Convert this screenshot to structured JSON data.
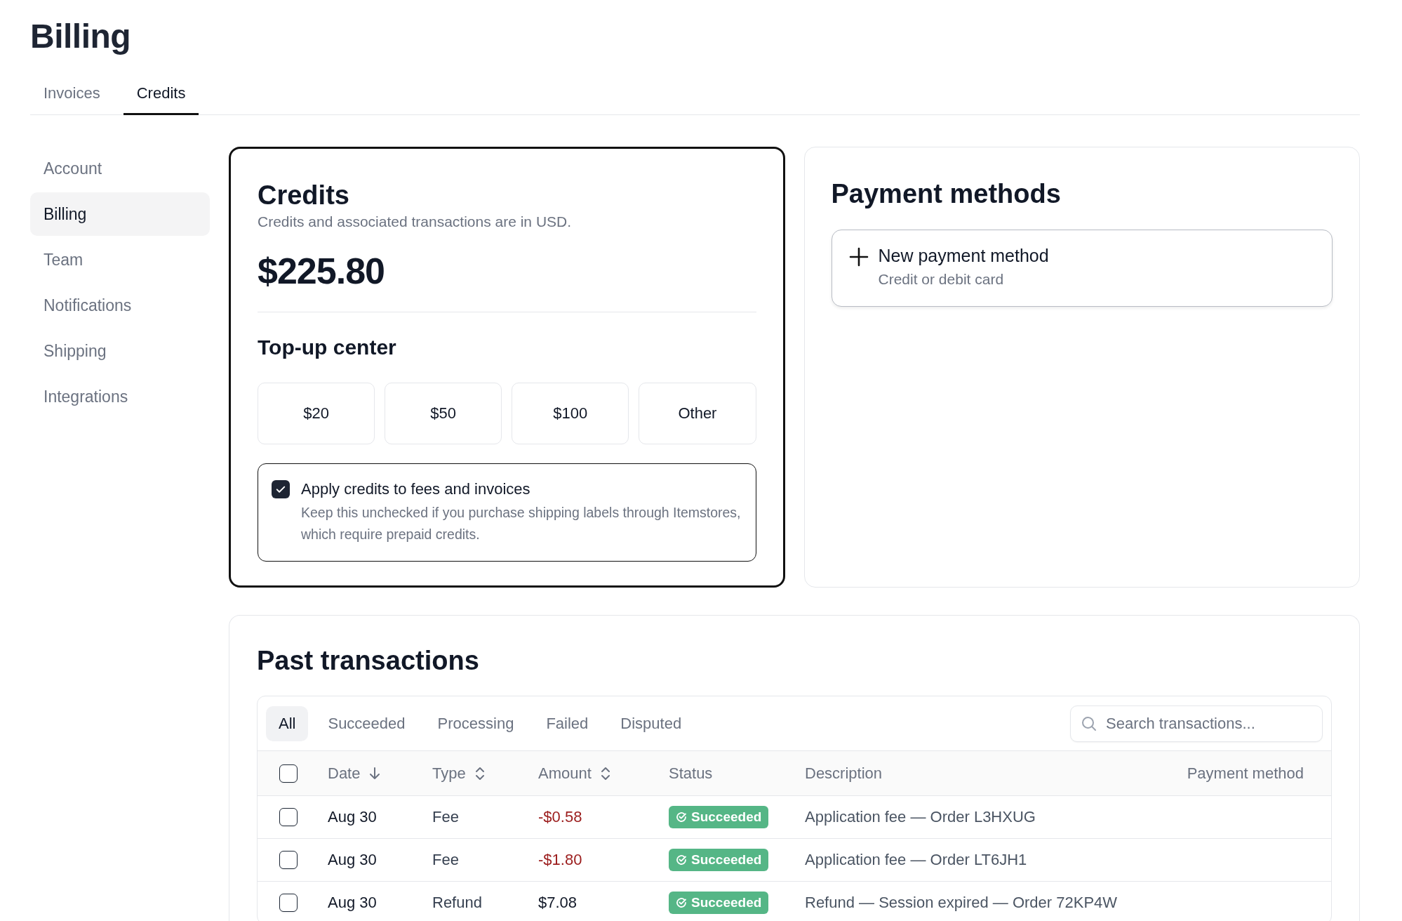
{
  "page": {
    "title": "Billing"
  },
  "tabs": [
    {
      "label": "Invoices",
      "selected": false
    },
    {
      "label": "Credits",
      "selected": true
    }
  ],
  "sidebar": {
    "items": [
      {
        "label": "Account",
        "selected": false
      },
      {
        "label": "Billing",
        "selected": true
      },
      {
        "label": "Team",
        "selected": false
      },
      {
        "label": "Notifications",
        "selected": false
      },
      {
        "label": "Shipping",
        "selected": false
      },
      {
        "label": "Integrations",
        "selected": false
      }
    ]
  },
  "credits": {
    "title": "Credits",
    "subtitle": "Credits and associated transactions are in USD.",
    "balance": "$225.80",
    "topup_title": "Top-up center",
    "topup_options": [
      "$20",
      "$50",
      "$100",
      "Other"
    ],
    "apply": {
      "label": "Apply credits to fees and invoices",
      "description": "Keep this unchecked if you purchase shipping labels through Itemstores, which require prepaid credits.",
      "checked": true
    }
  },
  "payment_methods": {
    "title": "Payment methods",
    "new_method": {
      "label": "New payment method",
      "sublabel": "Credit or debit card"
    }
  },
  "transactions": {
    "title": "Past transactions",
    "filters": [
      {
        "label": "All",
        "selected": true
      },
      {
        "label": "Succeeded",
        "selected": false
      },
      {
        "label": "Processing",
        "selected": false
      },
      {
        "label": "Failed",
        "selected": false
      },
      {
        "label": "Disputed",
        "selected": false
      }
    ],
    "search": {
      "placeholder": "Search transactions..."
    },
    "select_all": {
      "checked": false
    },
    "columns": [
      {
        "label": "Date",
        "kind": "sorted"
      },
      {
        "label": "Type",
        "kind": "sortable"
      },
      {
        "label": "Amount",
        "kind": "sortable"
      },
      {
        "label": "Status",
        "kind": "plain"
      },
      {
        "label": "Description",
        "kind": "plain"
      },
      {
        "label": "Payment method",
        "kind": "plain"
      }
    ],
    "rows": [
      {
        "checked": false,
        "date": "Aug 30",
        "type": "Fee",
        "amount": "-$0.58",
        "negative": true,
        "status": {
          "label": "Succeeded",
          "kind": "succeeded"
        },
        "description": "Application fee — Order L3HXUG"
      },
      {
        "checked": false,
        "date": "Aug 30",
        "type": "Fee",
        "amount": "-$1.80",
        "negative": true,
        "status": {
          "label": "Succeeded",
          "kind": "succeeded"
        },
        "description": "Application fee — Order LT6JH1"
      },
      {
        "checked": false,
        "date": "Aug 30",
        "type": "Refund",
        "amount": "$7.08",
        "negative": false,
        "status": {
          "label": "Succeeded",
          "kind": "succeeded"
        },
        "description": "Refund — Session expired — Order 72KP4W"
      }
    ]
  }
}
